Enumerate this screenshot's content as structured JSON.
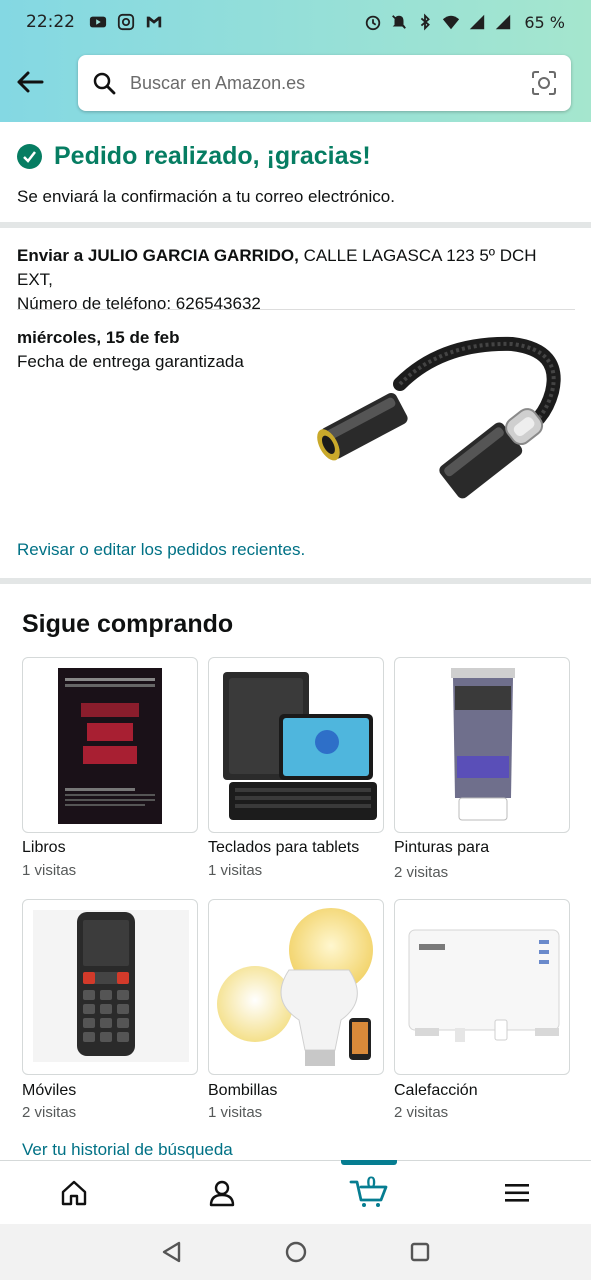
{
  "status_bar": {
    "time": "22:22",
    "battery": "65 %",
    "left_icons": [
      "youtube-icon",
      "instagram-icon",
      "gmail-icon"
    ],
    "right_icons": [
      "alarm-icon",
      "mute-icon",
      "bluetooth-icon",
      "wifi-icon",
      "signal-icon",
      "signal-icon"
    ]
  },
  "header": {
    "search_placeholder": "Buscar en Amazon.es"
  },
  "confirmation": {
    "title": "Pedido realizado, ¡gracias!",
    "subtitle": "Se enviará la confirmación a tu correo electrónico."
  },
  "shipping": {
    "label": "Enviar a",
    "name": "JULIO GARCIA GARRIDO,",
    "address": "CALLE LAGASCA 123 5º DCH EXT,",
    "phone_label": "Número de teléfono:",
    "phone": "626543632"
  },
  "delivery": {
    "date": "miércoles, 15 de feb",
    "note": "Fecha de entrega garantizada"
  },
  "review_link": "Revisar o editar los pedidos recientes.",
  "keep_shopping": {
    "title": "Sigue comprando",
    "items": [
      {
        "title": "Libros",
        "visits": "1 visitas"
      },
      {
        "title": "Teclados para tablets",
        "visits": "1 visitas"
      },
      {
        "title": "Pinturas para",
        "visits": "2 visitas"
      },
      {
        "title": "Móviles",
        "visits": "2 visitas"
      },
      {
        "title": "Bombillas",
        "visits": "1 visitas"
      },
      {
        "title": "Calefacción",
        "visits": "2 visitas"
      }
    ]
  },
  "history_link": "Ver tu historial de búsqueda",
  "bottom_nav": {
    "cart_count": "0"
  },
  "colors": {
    "success": "#067d62",
    "link": "#007185",
    "accent": "#067d91"
  }
}
